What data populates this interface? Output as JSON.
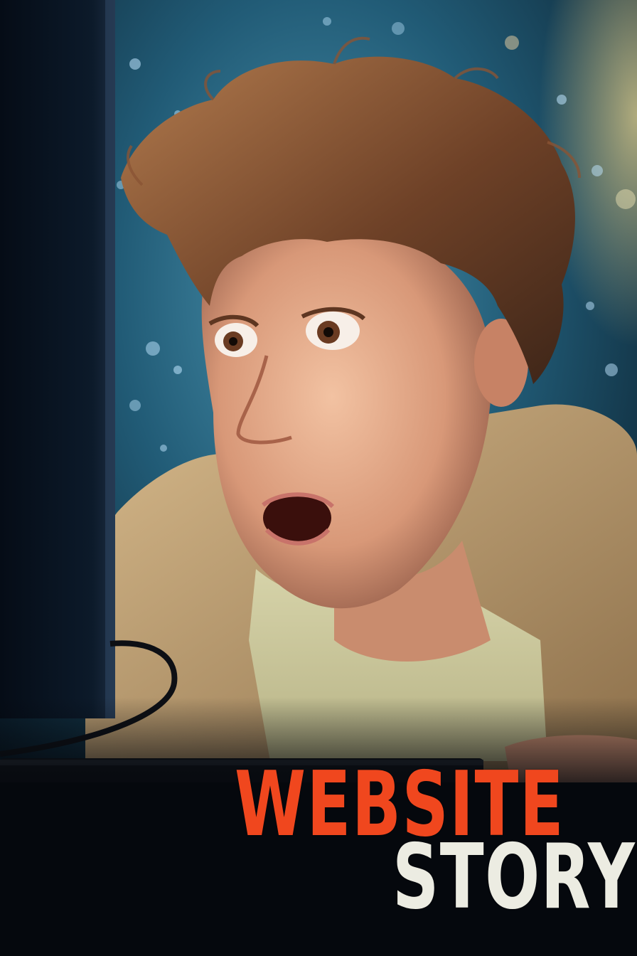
{
  "poster": {
    "title_line_1": "WEBSITE",
    "title_line_2": "STORY"
  },
  "colors": {
    "title_line_1": "#f0471e",
    "title_line_2": "#ecece2",
    "background_glow": "#2a6f8c",
    "desk": "#05080d"
  }
}
